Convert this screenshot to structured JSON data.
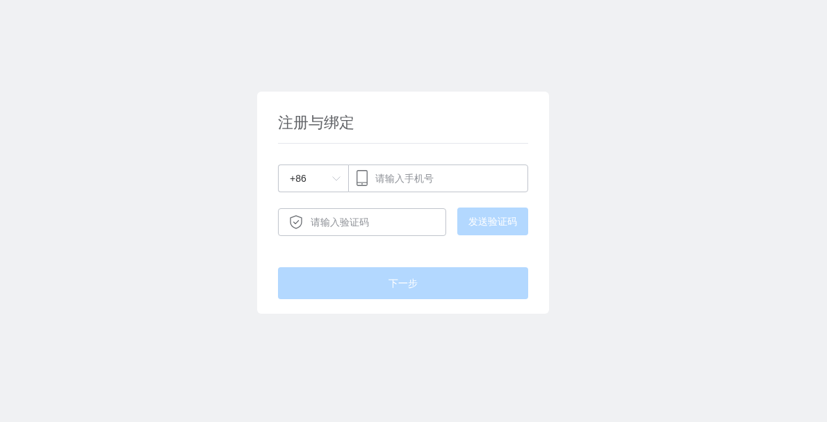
{
  "title": "注册与绑定",
  "phone": {
    "country_code": "+86",
    "placeholder": "请输入手机号"
  },
  "code": {
    "placeholder": "请输入验证码"
  },
  "send_button": {
    "label": "发送验证码",
    "disabled": true
  },
  "next_button": {
    "label": "下一步",
    "disabled": true
  }
}
